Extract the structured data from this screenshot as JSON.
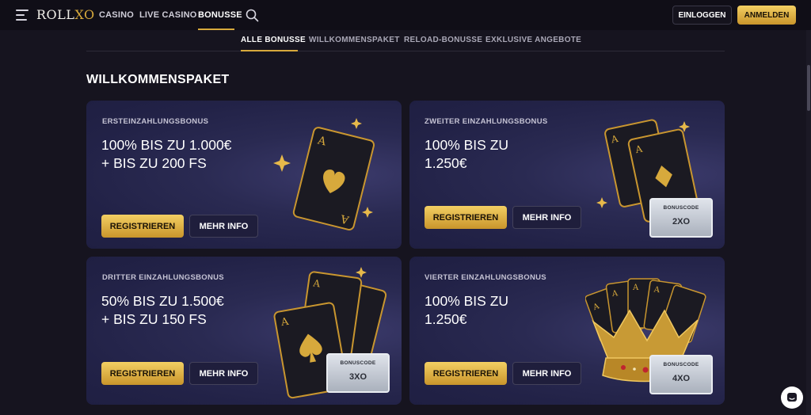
{
  "header": {
    "logo_text": "ROLL",
    "logo_accent": "XO",
    "nav": [
      {
        "label": "CASINO"
      },
      {
        "label": "LIVE CASINO"
      },
      {
        "label": "BONUSSE"
      }
    ],
    "login_label": "EINLOGGEN",
    "register_label": "ANMELDEN"
  },
  "subnav": [
    {
      "label": "ALLE BONUSSE"
    },
    {
      "label": "WILLKOMMENSPAKET"
    },
    {
      "label": "RELOAD-BONUSSE"
    },
    {
      "label": "EXKLUSIVE ANGEBOTE"
    }
  ],
  "section_title": "WILLKOMMENSPAKET",
  "cards": [
    {
      "label": "ERSTEINZAHLUNGSBONUS",
      "line1": "100% BIS ZU 1.000€",
      "line2": "+ BIS ZU 200 FS",
      "register": "REGISTRIEREN",
      "info": "MEHR INFO"
    },
    {
      "label": "ZWEITER EINZAHLUNGSBONUS",
      "line1": "100% BIS ZU",
      "line2": "1.250€",
      "register": "REGISTRIEREN",
      "info": "MEHR INFO",
      "bonuscode_label": "BONUSCODE",
      "bonuscode": "2XO"
    },
    {
      "label": "DRITTER EINZAHLUNGSBONUS",
      "line1": "50% BIS ZU 1.500€",
      "line2": "+ BIS ZU 150 FS",
      "register": "REGISTRIEREN",
      "info": "MEHR INFO",
      "bonuscode_label": "BONUSCODE",
      "bonuscode": "3XO"
    },
    {
      "label": "VIERTER EINZAHLUNGSBONUS",
      "line1": "100% BIS ZU",
      "line2": "1.250€",
      "register": "REGISTRIEREN",
      "info": "MEHR INFO",
      "bonuscode_label": "BONUSCODE",
      "bonuscode": "4XO"
    }
  ],
  "colors": {
    "gold": "#d7a93c",
    "background": "#16141f",
    "card": "#2a2a52"
  },
  "icons": [
    "menu-icon",
    "search-icon",
    "chat-icon"
  ]
}
